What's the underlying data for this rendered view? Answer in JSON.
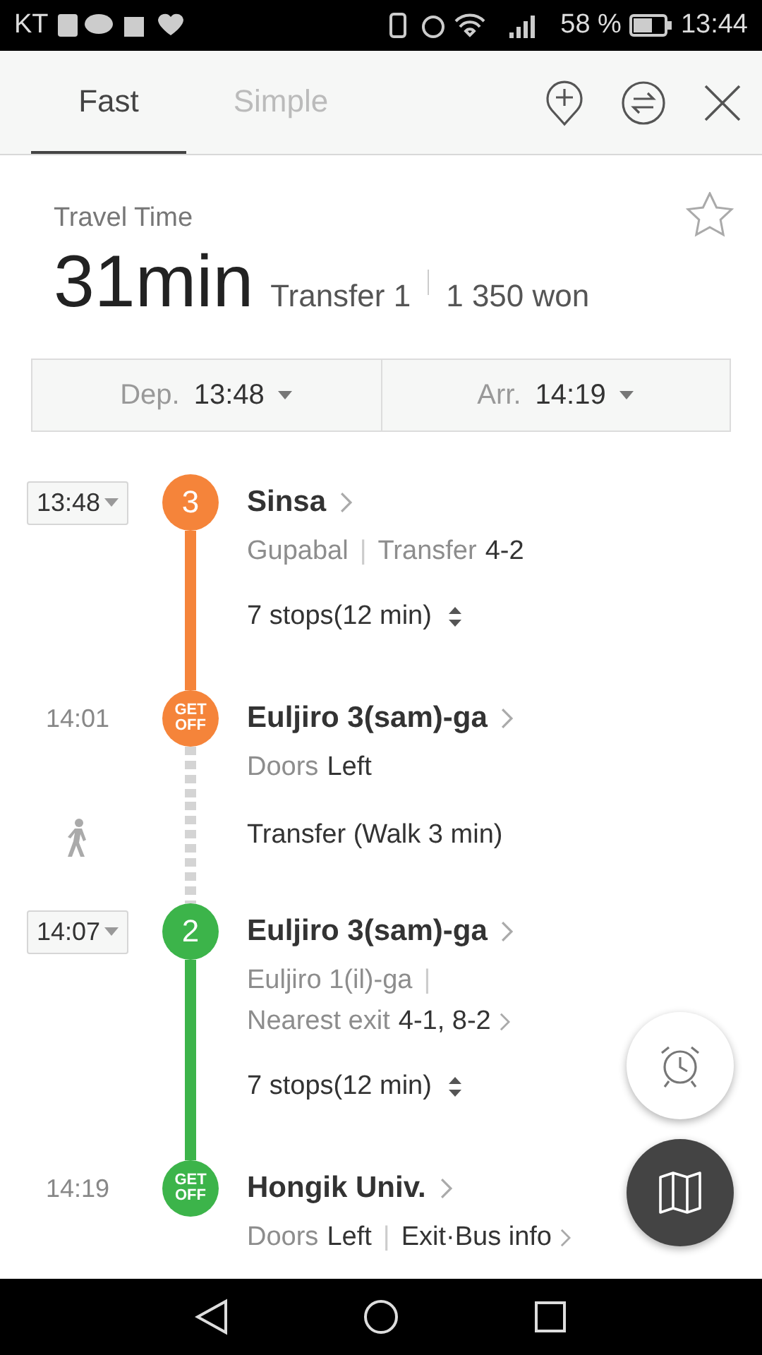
{
  "status_bar": {
    "carrier": "KT",
    "battery": "58 %",
    "time": "13:44"
  },
  "tabs": [
    {
      "label": "Fast",
      "selected": true
    },
    {
      "label": "Simple",
      "selected": false
    }
  ],
  "summary": {
    "label": "Travel Time",
    "duration": "31min",
    "transfers": "Transfer 1",
    "fare": "1 350 won"
  },
  "times": [
    {
      "label": "Dep.",
      "value": "13:48"
    },
    {
      "label": "Arr.",
      "value": "14:19"
    }
  ],
  "steps": [
    {
      "kind": "board",
      "time": "13:48",
      "badge": "3",
      "color": "#f5843a",
      "line_after": true,
      "station": "Sinsa",
      "details": [
        {
          "parts": [
            {
              "text": "Gupabal",
              "emphasized": false,
              "divider": false
            },
            {
              "text": "|",
              "divider": true
            },
            {
              "text": "Transfer",
              "emphasized": false,
              "divider": false
            },
            {
              "text": "4-2",
              "emphasized": true,
              "divider": false
            }
          ],
          "link": false
        }
      ],
      "stops": "7 stops(12 min)"
    },
    {
      "kind": "alight",
      "time": "14:01",
      "badge": "GET OFF",
      "color": "#f5843a",
      "line_after": true,
      "station": "Euljiro 3(sam)-ga",
      "details": [
        {
          "parts": [
            {
              "text": "Doors",
              "emphasized": false,
              "divider": false
            },
            {
              "text": "Left",
              "emphasized": true,
              "divider": false
            }
          ],
          "link": false
        }
      ]
    },
    {
      "kind": "walk",
      "text": "Transfer (Walk 3 min)",
      "line_after": true
    },
    {
      "kind": "board",
      "time": "14:07",
      "badge": "2",
      "color": "#3cb44a",
      "line_after": true,
      "station": "Euljiro 3(sam)-ga",
      "details": [
        {
          "parts": [
            {
              "text": "Euljiro 1(il)-ga",
              "emphasized": false,
              "divider": false
            },
            {
              "text": "|",
              "divider": true
            }
          ],
          "link": false
        },
        {
          "parts": [
            {
              "text": "Nearest exit",
              "emphasized": false,
              "divider": false
            },
            {
              "text": "4-1, 8-2",
              "emphasized": true,
              "divider": false
            }
          ],
          "link": true
        }
      ],
      "stops": "7 stops(12 min)"
    },
    {
      "kind": "alight",
      "time": "14:19",
      "badge": "GET OFF",
      "color": "#3cb44a",
      "line_after": false,
      "station": "Hongik Univ.",
      "details": [
        {
          "parts": [
            {
              "text": "Doors",
              "emphasized": false,
              "divider": false
            },
            {
              "text": "Left",
              "emphasized": true,
              "divider": false
            },
            {
              "text": "|",
              "divider": true
            },
            {
              "text": "Exit·Bus info",
              "emphasized": true,
              "divider": false
            }
          ],
          "link": true
        }
      ]
    }
  ]
}
